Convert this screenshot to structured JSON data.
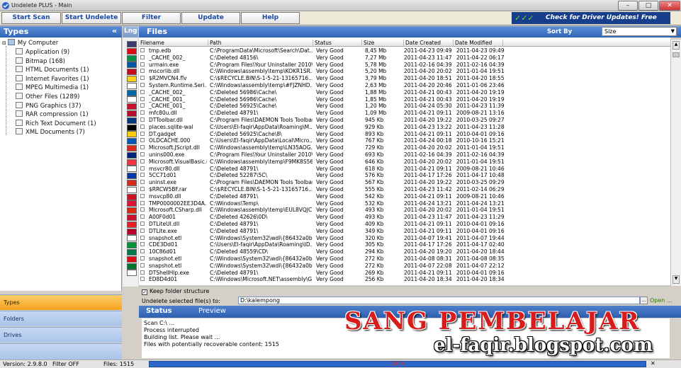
{
  "window": {
    "title": "Undelete PLUS - Main"
  },
  "toolbar": {
    "buttons": [
      "Start Scan",
      "Start Undelete",
      "Filter",
      "Update",
      "Help"
    ],
    "promo": "Check for Driver Updates! Free Scan!",
    "promo_checks": "✓✓✓"
  },
  "types_panel": {
    "title": "Types",
    "collapse": "«",
    "root": "My Computer",
    "items": [
      "Application (9)",
      "Bitmap (168)",
      "HTML Documents (1)",
      "Internet Favorites (1)",
      "MPEG Multimedia (1)",
      "Other Files (1289)",
      "PNG Graphics (37)",
      "RAR compression (1)",
      "Rich Text Document (1)",
      "XML Documents (7)"
    ],
    "nav": [
      "Types",
      "Folders",
      "Drives"
    ]
  },
  "lng": {
    "title": "Lng"
  },
  "files": {
    "title": "Files",
    "sort_label": "Sort By",
    "sort_value": "Size",
    "columns": [
      "Filename",
      "Path",
      "Status",
      "Size",
      "Date Created",
      "Date Modified"
    ],
    "rows": [
      [
        "tmp.edb",
        "C:\\ProgramData\\Microsoft\\Search\\Dat...",
        "Very Good",
        "8,45 Mb",
        "2011-04-23 09:49",
        "2011-04-23 09:49"
      ],
      [
        "_CACHE_002_",
        "C:\\Deleted 48156\\",
        "Very Good",
        "7,27 Mb",
        "2011-04-23 11:47",
        "2011-04-22 06:17"
      ],
      [
        "urmain.exe",
        "C:\\Program Files\\Your Uninstaller 2010\\",
        "Very Good",
        "5,78 Mb",
        "2011-02-16 04:39",
        "2011-02-16 04:39"
      ],
      [
        "mscorlib.dll",
        "C:\\Windows\\assembly\\temp\\KOKR1SR...",
        "Very Good",
        "5,20 Mb",
        "2011-04-20 20:02",
        "2011-01-04 19:51"
      ],
      [
        "$R2MVCN4.flv",
        "C:\\$RECYCLE.BIN\\S-1-5-21-13165716...",
        "Very Good",
        "3,79 Mb",
        "2011-04-20 18:51",
        "2011-04-20 18:55"
      ],
      [
        "System.Runtime.Seri...",
        "C:\\Windows\\assembly\\temp\\#FJZNHD...",
        "Very Good",
        "2,63 Mb",
        "2011-04-20 20:46",
        "2011-01-06 23:46"
      ],
      [
        "_CACHE_002_",
        "C:\\Deleted 56986\\Cache\\",
        "Very Good",
        "1,88 Mb",
        "2011-04-21 00:43",
        "2011-04-20 19:19"
      ],
      [
        "_CACHE_001_",
        "C:\\Deleted 56986\\Cache\\",
        "Very Good",
        "1,85 Mb",
        "2011-04-21 00:43",
        "2011-04-20 19:19"
      ],
      [
        "_CACHE_001_",
        "C:\\Deleted 56925\\Cache\\",
        "Very Good",
        "1,20 Mb",
        "2011-04-24 05:30",
        "2011-04-23 11:39"
      ],
      [
        "mfc80u.dll",
        "C:\\Deleted 48791\\",
        "Very Good",
        "1,09 Mb",
        "2011-04-21 09:11",
        "2009-08-21 13:16"
      ],
      [
        "DTToolbar.dll",
        "C:\\Program Files\\DAEMON Tools Toolbar\\",
        "Very Good",
        "945 Kb",
        "2011-04-20 19:22",
        "2010-03-25 09:27"
      ],
      [
        "places.sqlite-wal",
        "C:\\Users\\El-faqir\\AppData\\Roaming\\M...",
        "Very Good",
        "929 Kb",
        "2011-04-23 13:22",
        "2011-04-23 11:28"
      ],
      [
        "DT.gadget",
        "C:\\Deleted 56925\\Cache\\8\\",
        "Very Good",
        "893 Kb",
        "2011-04-21 09:11",
        "2010-04-01 09:16"
      ],
      [
        "OLDCACHE.000",
        "C:\\Users\\El-faqir\\AppData\\Local\\Micro...",
        "Very Good",
        "767 Kb",
        "2011-04-24 00:18",
        "2010-10-16 15:21"
      ],
      [
        "Microsoft.JScript.dll",
        "C:\\Windows\\assembly\\temp\\LN35AOG...",
        "Very Good",
        "729 Kb",
        "2011-04-20 20:02",
        "2011-01-04 19:51"
      ],
      [
        "unins000.exe",
        "C:\\Program Files\\Your Uninstaller 2010\\",
        "Very Good",
        "693 Kb",
        "2011-02-16 04:39",
        "2011-02-16 04:39"
      ],
      [
        "Microsoft.VisualBasic.dll",
        "C:\\Windows\\assembly\\temp\\F9MK8S56...",
        "Very Good",
        "646 Kb",
        "2011-04-20 20:02",
        "2011-01-04 19:51"
      ],
      [
        "msvcr80.dll",
        "C:\\Deleted 48791\\",
        "Very Good",
        "618 Kb",
        "2011-04-21 09:11",
        "2009-08-21 10:46"
      ],
      [
        "5CC71d01",
        "C:\\Deleted 52287\\5C\\",
        "Very Good",
        "576 Kb",
        "2011-04-17 17:26",
        "2011-04-17 10:48"
      ],
      [
        "uninst.exe",
        "C:\\Program Files\\DAEMON Tools Toolbar\\",
        "Very Good",
        "567 Kb",
        "2011-04-20 19:22",
        "2010-03-25 09:29"
      ],
      [
        "$RRCW5BF.rar",
        "C:\\$RECYCLE.BIN\\S-1-5-21-13165716...",
        "Very Good",
        "555 Kb",
        "2011-04-23 11:42",
        "2011-02-14 06:29"
      ],
      [
        "msvcp80.dll",
        "C:\\Deleted 48791\\",
        "Very Good",
        "542 Kb",
        "2011-04-21 09:11",
        "2009-08-21 10:46"
      ],
      [
        "TMP0000002EE3D4A...",
        "C:\\Windows\\Temp\\",
        "Very Good",
        "532 Kb",
        "2011-04-24 13:21",
        "2011-04-24 13:21"
      ],
      [
        "Microsoft.CSharp.dll",
        "C:\\Windows\\assembly\\temp\\EUL8VQJC...",
        "Very Good",
        "493 Kb",
        "2011-04-20 20:02",
        "2011-01-04 19:51"
      ],
      [
        "A00F0d01",
        "C:\\Deleted 42626\\0D\\",
        "Very Good",
        "493 Kb",
        "2011-04-23 11:47",
        "2011-04-23 11:29"
      ],
      [
        "DTLiteUI.dll",
        "C:\\Deleted 48791\\",
        "Very Good",
        "409 Kb",
        "2011-04-21 09:11",
        "2010-04-01 09:16"
      ],
      [
        "DTLite.exe",
        "C:\\Deleted 48791\\",
        "Very Good",
        "349 Kb",
        "2011-04-21 09:11",
        "2010-04-01 09:16"
      ],
      [
        "snapshot.etl",
        "C:\\Windows\\System32\\wdi\\{86432a0b...",
        "Very Good",
        "320 Kb",
        "2011-04-07 19:41",
        "2011-04-07 19:44"
      ],
      [
        "CDE3Dd01",
        "C:\\Users\\El-faqir\\AppData\\Roaming\\ID...",
        "Very Good",
        "305 Kb",
        "2011-04-17 17:26",
        "2011-04-17 02:40"
      ],
      [
        "10C86d01",
        "C:\\Deleted 48559\\CD\\",
        "Very Good",
        "294 Kb",
        "2011-04-20 19:20",
        "2011-04-20 18:44"
      ],
      [
        "snapshot.etl",
        "C:\\Windows\\System32\\wdi\\{86432a0b...",
        "Very Good",
        "272 Kb",
        "2011-04-08 08:31",
        "2011-04-08 08:35"
      ],
      [
        "snapshot.etl",
        "C:\\Windows\\System32\\wdi\\{86432a0b...",
        "Very Good",
        "272 Kb",
        "2011-04-07 22:08",
        "2011-04-07 22:12"
      ],
      [
        "DTShellHlp.exe",
        "C:\\Deleted 48791\\",
        "Very Good",
        "269 Kb",
        "2011-04-21 09:11",
        "2010-04-01 09:16"
      ],
      [
        "ED8D4d01",
        "C:\\Windows\\Microsoft.NET\\assembly\\G...",
        "Very Good",
        "256 Kb",
        "2011-04-20 18:34",
        "2011-04-20 18:34"
      ]
    ],
    "keep_structure": "Keep folder structure",
    "undelete_label": "Undelete selected file(s) to:",
    "undelete_path": "D:\\kalempong",
    "browse": "...",
    "open": "Open ..."
  },
  "status_panel": {
    "tabs": [
      "Status",
      "Preview"
    ],
    "log": [
      "Scan C:\\ ...",
      "Process interrupted",
      "Building list. Please wait ...",
      "Files with potentially recoverable content: 1515"
    ]
  },
  "statusbar": {
    "version": "Version: 2.9.8.0",
    "filter": "Filter OFF",
    "files": "Files: 1515",
    "progress_label": "100%",
    "progress": 1.0
  },
  "watermark": {
    "line1": "SANG PEMBELAJAR",
    "line2": "el-faqir.blogspot.com"
  },
  "flags": [
    "#3c3b6e",
    "#e30a17",
    "#009246",
    "#0055a4",
    "#c60b1e",
    "#fcd116",
    "#ffffff",
    "#006aa7",
    "#ffffff",
    "#c8102e",
    "#ba0c2f",
    "#003580",
    "#000000",
    "#ffce00",
    "#0057b7",
    "#da291c",
    "#00247d",
    "#ef3340",
    "#ffffff",
    "#0039a6",
    "#d52b1e",
    "#ffffff",
    "#ce1126",
    "#dc143c",
    "#de2910",
    "#c8102e",
    "#ee1c25",
    "#bc002d",
    "#ffffff",
    "#009739",
    "#007a4d",
    "#e30a17",
    "#00732f",
    "#ffffff"
  ]
}
